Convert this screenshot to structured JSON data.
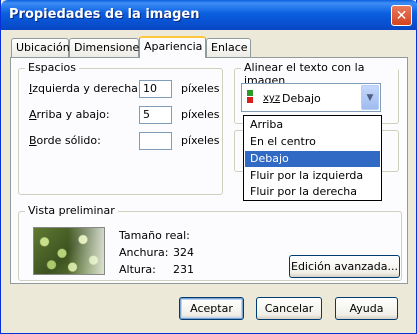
{
  "window": {
    "title": "Propiedades de la imagen",
    "close_glyph": "✕"
  },
  "tabs": [
    {
      "label": "Ubicación",
      "active": false
    },
    {
      "label": "Dimensiones",
      "active": false
    },
    {
      "label": "Apariencia",
      "active": true
    },
    {
      "label": "Enlace",
      "active": false
    }
  ],
  "spacing": {
    "legend": "Espacios",
    "horizontal": {
      "label_prefix": "I",
      "label_rest": "zquierda y derecha:",
      "value": "10",
      "unit": "píxeles"
    },
    "vertical": {
      "label_prefix": "A",
      "label_rest": "rriba y abajo:",
      "value": "5",
      "unit": "píxeles"
    },
    "border": {
      "label_prefix": "B",
      "label_rest": "orde sólido:",
      "value": "",
      "unit": "píxeles"
    }
  },
  "align": {
    "legend": "Alinear el texto con la imagen",
    "icon_text": "xyz",
    "selected": "Debajo",
    "options": [
      "Arriba",
      "En el centro",
      "Debajo",
      "Fluir por la izquierda",
      "Fluir por la derecha"
    ],
    "selected_index": 2
  },
  "preview": {
    "legend": "Vista preliminar",
    "real_size_label": "Tamaño real:",
    "width_label": "Anchura:",
    "width_value": "324",
    "height_label": "Altura:",
    "height_value": "231"
  },
  "buttons": {
    "advanced": "Edición avanzada...",
    "ok": "Aceptar",
    "cancel": "Cancelar",
    "help": "Ayuda"
  },
  "colors": {
    "titlebar": "#0a5fe0",
    "selection": "#316ac5",
    "window_bg": "#ece9d8"
  }
}
